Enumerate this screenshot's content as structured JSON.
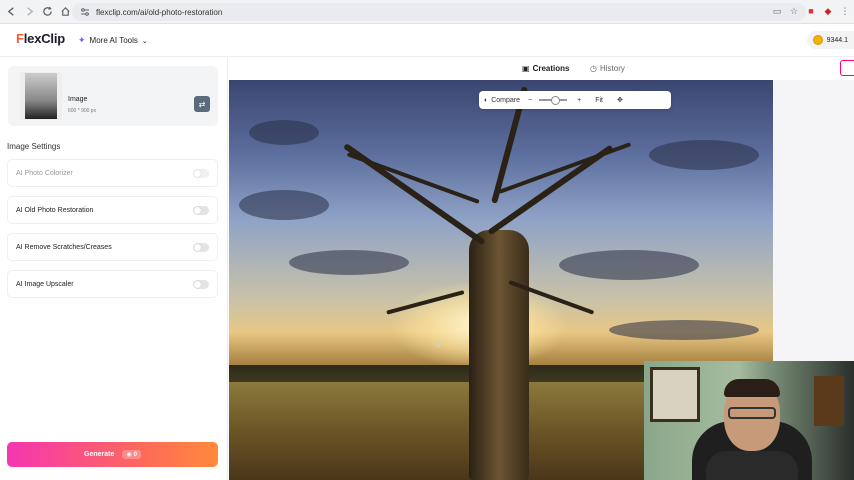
{
  "browser": {
    "url": "flexclip.com/ai/old-photo-restoration"
  },
  "header": {
    "logo_text": "FlexClip",
    "more_tools_label": "More AI Tools",
    "coins": "9344.1"
  },
  "sidebar": {
    "image_card": {
      "title": "Image",
      "size": "600 * 900 px"
    },
    "section_title": "Image Settings",
    "settings": [
      {
        "label": "AI Photo Colorizer",
        "enabled": false,
        "disabled": true
      },
      {
        "label": "AI Old Photo Restoration",
        "enabled": false,
        "disabled": false
      },
      {
        "label": "AI Remove Scratches/Creases",
        "enabled": false,
        "disabled": false
      },
      {
        "label": "AI Image Upscaler",
        "enabled": false,
        "disabled": false
      }
    ],
    "generate": {
      "label": "Generate",
      "cost": "0"
    }
  },
  "tabs": {
    "creations": "Creations",
    "history": "History"
  },
  "toolbar": {
    "compare": "Compare",
    "minus": "−",
    "plus": "+",
    "fit": "Fit"
  },
  "colors": {
    "accent_pink": "#f536b0",
    "accent_orange": "#ff8a3a",
    "logo_accent": "#ff5a36"
  }
}
